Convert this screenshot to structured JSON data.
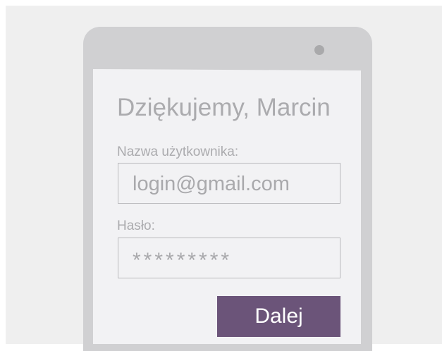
{
  "login": {
    "heading": "Dziękujemy, Marcin",
    "username_label": "Nazwa użytkownika:",
    "username_value": "login@gmail.com",
    "password_label": "Hasło:",
    "password_value": "*********",
    "next_label": "Dalej"
  },
  "colors": {
    "background": "#efefef",
    "phone_frame": "#d0d0d2",
    "screen": "#f2f2f4",
    "text": "#ababae",
    "button": "#6b5479",
    "button_text": "#ffffff"
  }
}
